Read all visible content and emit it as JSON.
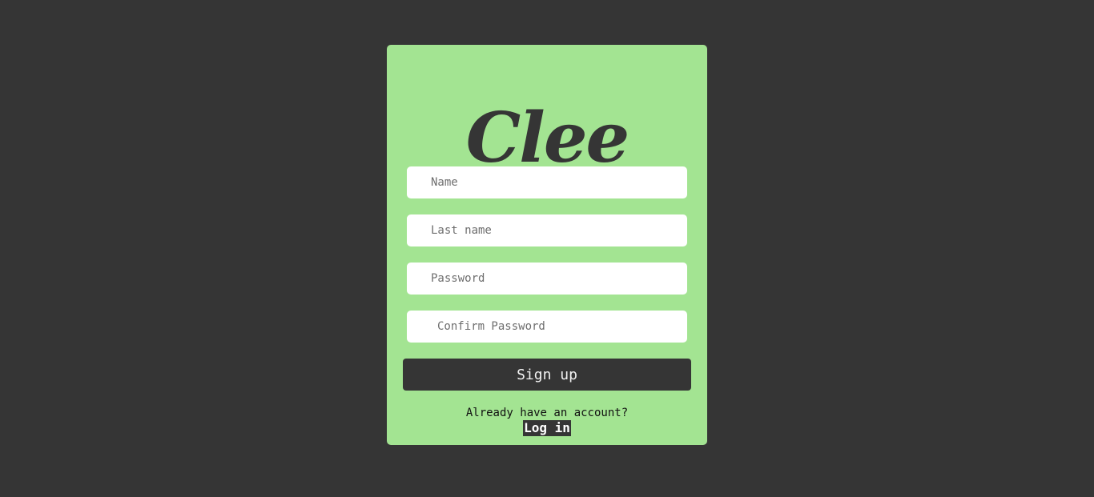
{
  "brand": {
    "logo_text": "Clee"
  },
  "form": {
    "name_placeholder": "Name",
    "last_name_placeholder": "Last name",
    "password_placeholder": "Password",
    "confirm_password_placeholder": "Confirm Password",
    "signup_label": "Sign up"
  },
  "footer": {
    "prompt": "Already have an account?",
    "login_label": "Log in"
  },
  "colors": {
    "background": "#353535",
    "card": "#a3e492",
    "input": "#ffffff",
    "button": "#353535"
  }
}
